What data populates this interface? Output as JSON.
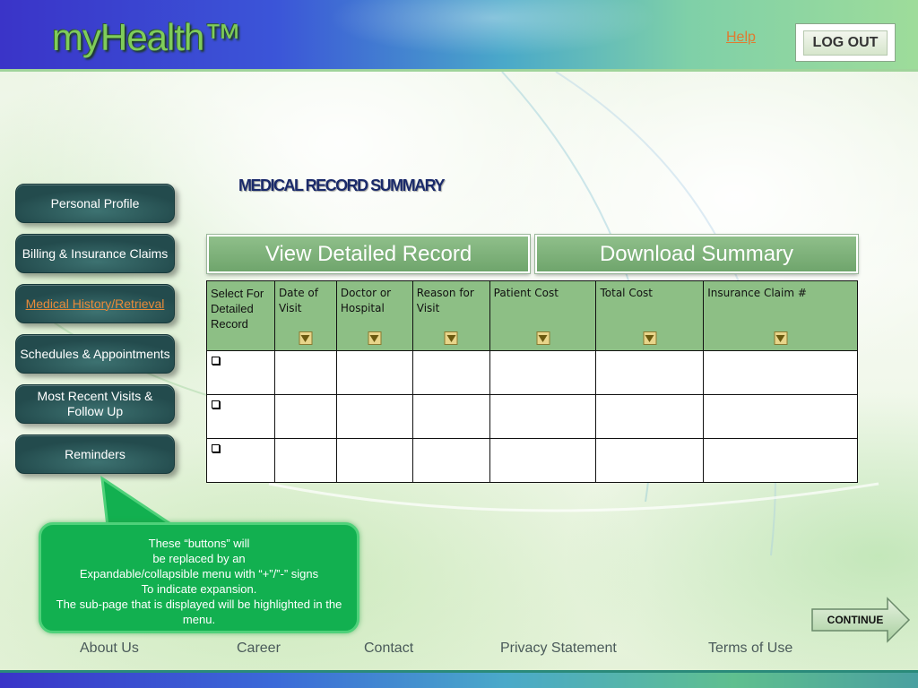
{
  "header": {
    "logo": "myHealth™",
    "help_label": "Help",
    "logout_label": "LOG OUT"
  },
  "page_title": "MEDICAL RECORD SUMMARY",
  "sidebar": {
    "items": [
      {
        "label": "Personal Profile",
        "active": false
      },
      {
        "label": "Billing & Insurance Claims",
        "active": false
      },
      {
        "label": "Medical History/Retrieval",
        "active": true
      },
      {
        "label": "Schedules & Appointments",
        "active": false
      },
      {
        "label": "Most Recent Visits & Follow Up",
        "active": false
      },
      {
        "label": "Reminders",
        "active": false
      }
    ]
  },
  "actions": {
    "view_label": "View Detailed Record",
    "download_label": "Download Summary"
  },
  "table": {
    "columns": [
      "Select For Detailed Record",
      "Date of Visit",
      "Doctor or Hospital",
      "Reason for Visit",
      "Patient Cost",
      "Total Cost",
      "Insurance Claim #"
    ],
    "rows": [
      [
        "",
        "",
        "",
        "",
        "",
        ""
      ],
      [
        "",
        "",
        "",
        "",
        "",
        ""
      ],
      [
        "",
        "",
        "",
        "",
        "",
        ""
      ]
    ]
  },
  "callout": {
    "lines": [
      "These “buttons” will",
      "be replaced by an",
      "Expandable/collapsible menu with “+”/”-” signs",
      "To indicate expansion.",
      "The sub-page that is displayed will be highlighted in the menu."
    ]
  },
  "continue_label": "CONTINUE",
  "footer": {
    "links": [
      "About Us",
      "Career",
      "Contact",
      "Privacy Statement",
      "Terms of Use"
    ]
  },
  "colors": {
    "nav_button": "#2c5a5b",
    "table_header": "#8dbf85",
    "callout": "#12b050",
    "active_link": "#e88a3a"
  }
}
